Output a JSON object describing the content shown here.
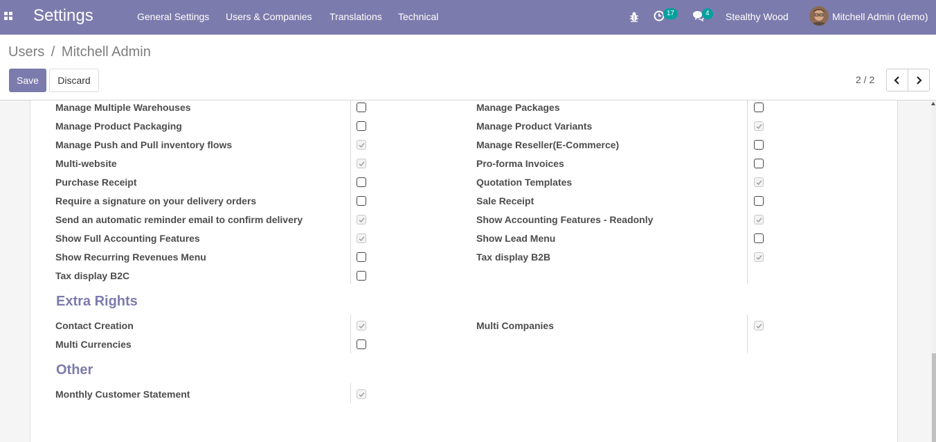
{
  "navbar": {
    "app_title": "Settings",
    "menu": [
      "General Settings",
      "Users & Companies",
      "Translations",
      "Technical"
    ],
    "activity_count": "17",
    "message_count": "4",
    "company": "Stealthy Wood",
    "user": "Mitchell Admin (demo)"
  },
  "breadcrumb": {
    "parent": "Users",
    "separator": "/",
    "current": "Mitchell Admin"
  },
  "buttons": {
    "save": "Save",
    "discard": "Discard"
  },
  "pager": {
    "value": "2 / 2"
  },
  "technical_rows": [
    {
      "left": "Manage Multiple Warehouses",
      "left_checked": false,
      "right": "Manage Packages",
      "right_checked": false
    },
    {
      "left": "Manage Product Packaging",
      "left_checked": false,
      "right": "Manage Product Variants",
      "right_checked": true
    },
    {
      "left": "Manage Push and Pull inventory flows",
      "left_checked": true,
      "right": "Manage Reseller(E-Commerce)",
      "right_checked": false
    },
    {
      "left": "Multi-website",
      "left_checked": true,
      "right": "Pro-forma Invoices",
      "right_checked": false
    },
    {
      "left": "Purchase Receipt",
      "left_checked": false,
      "right": "Quotation Templates",
      "right_checked": true
    },
    {
      "left": "Require a signature on your delivery orders",
      "left_checked": false,
      "right": "Sale Receipt",
      "right_checked": false
    },
    {
      "left": "Send an automatic reminder email to confirm delivery",
      "left_checked": true,
      "right": "Show Accounting Features - Readonly",
      "right_checked": true
    },
    {
      "left": "Show Full Accounting Features",
      "left_checked": true,
      "right": "Show Lead Menu",
      "right_checked": false
    },
    {
      "left": "Show Recurring Revenues Menu",
      "left_checked": false,
      "right": "Tax display B2B",
      "right_checked": true
    },
    {
      "left": "Tax display B2C",
      "left_checked": false
    }
  ],
  "extra_rights": {
    "title": "Extra Rights",
    "rows": [
      {
        "left": "Contact Creation",
        "left_checked": true,
        "right": "Multi Companies",
        "right_checked": true
      },
      {
        "left": "Multi Currencies",
        "left_checked": false
      }
    ]
  },
  "other": {
    "title": "Other",
    "rows": [
      {
        "left": "Monthly Customer Statement",
        "left_checked": true
      }
    ]
  }
}
